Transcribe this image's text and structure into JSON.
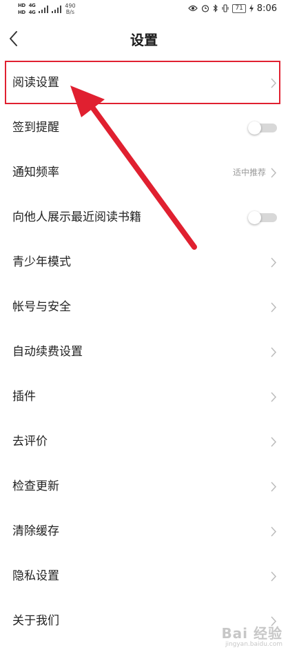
{
  "status_bar": {
    "hd_1": "HD",
    "hd_2": "HD",
    "net_1": "4G",
    "net_2": "4G",
    "speed_value": "490",
    "speed_unit": "B/s",
    "battery": "71",
    "time": "8:06"
  },
  "header": {
    "title": "设置"
  },
  "settings": {
    "items": [
      {
        "label": "阅读设置",
        "control": "chevron"
      },
      {
        "label": "签到提醒",
        "control": "toggle",
        "on": false
      },
      {
        "label": "通知频率",
        "control": "chevron",
        "value": "适中推荐"
      },
      {
        "label": "向他人展示最近阅读书籍",
        "control": "toggle",
        "on": false
      },
      {
        "label": "青少年模式",
        "control": "chevron"
      },
      {
        "label": "帐号与安全",
        "control": "chevron"
      },
      {
        "label": "自动续费设置",
        "control": "chevron"
      },
      {
        "label": "插件",
        "control": "chevron"
      },
      {
        "label": "去评价",
        "control": "chevron"
      },
      {
        "label": "检查更新",
        "control": "chevron"
      },
      {
        "label": "清除缓存",
        "control": "chevron"
      },
      {
        "label": "隐私设置",
        "control": "chevron"
      },
      {
        "label": "关于我们",
        "control": "chevron"
      }
    ]
  },
  "annotation": {
    "color": "#e02030"
  },
  "watermark": {
    "main": "Bai 经验",
    "sub": "jingyan.baidu.com"
  }
}
